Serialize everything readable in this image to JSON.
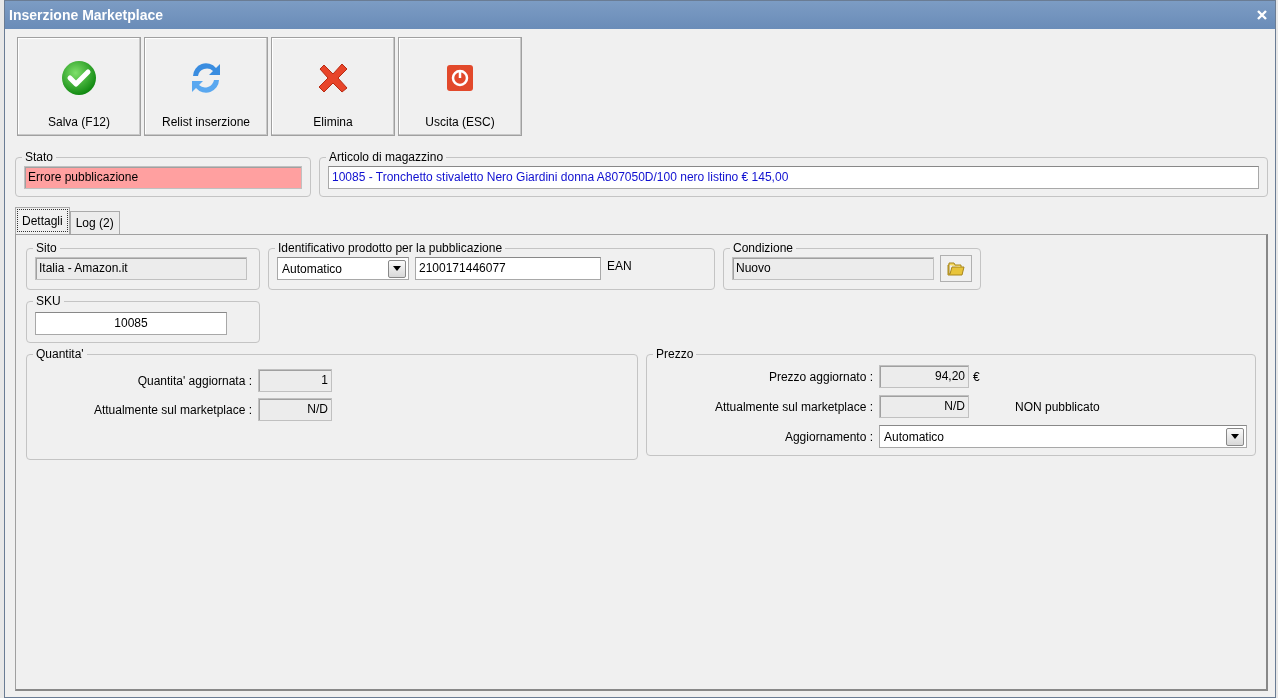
{
  "window": {
    "title": "Inserzione Marketplace"
  },
  "toolbar": [
    {
      "label": "Salva (F12)",
      "kind": "save"
    },
    {
      "label": "Relist inserzione",
      "kind": "relist"
    },
    {
      "label": "Elimina",
      "kind": "delete"
    },
    {
      "label": "Uscita (ESC)",
      "kind": "exit"
    }
  ],
  "stato": {
    "label": "Stato",
    "value": "Errore pubblicazione",
    "kind": "error"
  },
  "articolo": {
    "label": "Articolo di magazzino",
    "value": "10085 - Tronchetto stivaletto Nero Giardini donna A807050D/100 nero listino € 145,00"
  },
  "tabs": [
    {
      "label": "Dettagli",
      "selected": true
    },
    {
      "label": "Log (2)",
      "selected": false
    }
  ],
  "sito": {
    "label": "Sito",
    "value": "Italia - Amazon.it"
  },
  "identificativo": {
    "label": "Identificativo prodotto per la pubblicazione",
    "type": "Automatico",
    "code": "2100171446077",
    "suffix": "EAN"
  },
  "condizione": {
    "label": "Condizione",
    "value": "Nuovo"
  },
  "sku": {
    "label": "SKU",
    "value": "10085"
  },
  "quantita": {
    "label": "Quantita'",
    "rows": [
      {
        "label": "Quantita' aggiornata :",
        "value": "1"
      },
      {
        "label": "Attualmente sul marketplace :",
        "value": "N/D"
      }
    ]
  },
  "prezzo": {
    "label": "Prezzo",
    "rows": [
      {
        "label": "Prezzo aggiornato :",
        "value": "94,20",
        "unit": "€"
      },
      {
        "label": "Attualmente sul marketplace :",
        "value": "N/D",
        "note": "NON pubblicato"
      }
    ],
    "aggiornamento": {
      "label": "Aggiornamento :",
      "value": "Automatico"
    }
  }
}
